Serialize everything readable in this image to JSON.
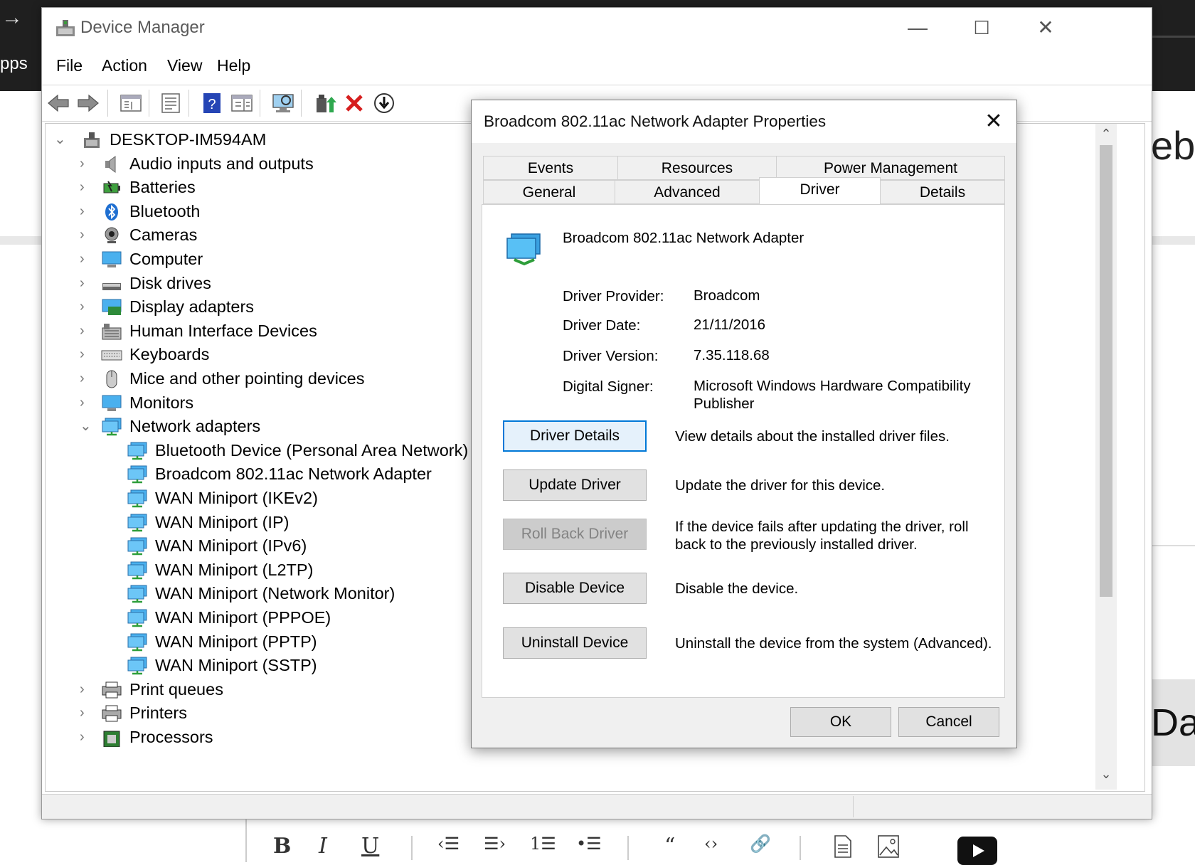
{
  "background": {
    "left_text": "pps",
    "right_text": "ebru",
    "right_text2": "Dat"
  },
  "window": {
    "title": "Device Manager",
    "controls": {
      "minimize": "—",
      "maximize": "☐",
      "close": "✕"
    }
  },
  "menu": [
    "File",
    "Action",
    "View",
    "Help"
  ],
  "tree": {
    "root": "DESKTOP-IM594AM",
    "categories": [
      {
        "label": "Audio inputs and outputs",
        "icon": "speaker-icon"
      },
      {
        "label": "Batteries",
        "icon": "battery-icon"
      },
      {
        "label": "Bluetooth",
        "icon": "bluetooth-icon"
      },
      {
        "label": "Cameras",
        "icon": "camera-icon"
      },
      {
        "label": "Computer",
        "icon": "computer-icon"
      },
      {
        "label": "Disk drives",
        "icon": "disk-icon"
      },
      {
        "label": "Display adapters",
        "icon": "display-adapter-icon"
      },
      {
        "label": "Human Interface Devices",
        "icon": "hid-icon"
      },
      {
        "label": "Keyboards",
        "icon": "keyboard-icon"
      },
      {
        "label": "Mice and other pointing devices",
        "icon": "mouse-icon"
      },
      {
        "label": "Monitors",
        "icon": "monitor-icon"
      },
      {
        "label": "Network adapters",
        "icon": "network-icon",
        "expanded": true
      }
    ],
    "network_children": [
      "Bluetooth Device (Personal Area Network)",
      "Broadcom 802.11ac Network Adapter",
      "WAN Miniport (IKEv2)",
      "WAN Miniport (IP)",
      "WAN Miniport (IPv6)",
      "WAN Miniport (L2TP)",
      "WAN Miniport (Network Monitor)",
      "WAN Miniport (PPPOE)",
      "WAN Miniport (PPTP)",
      "WAN Miniport (SSTP)"
    ],
    "after": [
      {
        "label": "Print queues",
        "icon": "printer-icon"
      },
      {
        "label": "Printers",
        "icon": "printer-icon"
      },
      {
        "label": "Processors",
        "icon": "processor-icon"
      }
    ]
  },
  "dialog": {
    "title": "Broadcom 802.11ac Network Adapter Properties",
    "tabs_row1": [
      "Events",
      "Resources",
      "Power Management"
    ],
    "tabs_row2": [
      "General",
      "Advanced",
      "Driver",
      "Details"
    ],
    "active_tab": "Driver",
    "device_name": "Broadcom 802.11ac Network Adapter",
    "info": [
      {
        "label": "Driver Provider:",
        "value": "Broadcom"
      },
      {
        "label": "Driver Date:",
        "value": "21/11/2016"
      },
      {
        "label": "Driver Version:",
        "value": "7.35.118.68"
      },
      {
        "label": "Digital Signer:",
        "value": "Microsoft Windows Hardware Compatibility Publisher"
      }
    ],
    "actions": [
      {
        "button": "Driver Details",
        "desc": "View details about the installed driver files."
      },
      {
        "button": "Update Driver",
        "desc": "Update the driver for this device."
      },
      {
        "button": "Roll Back Driver",
        "desc": "If the device fails after updating the driver, roll back to the previously installed driver.",
        "disabled": true
      },
      {
        "button": "Disable Device",
        "desc": "Disable the device."
      },
      {
        "button": "Uninstall Device",
        "desc": "Uninstall the device from the system (Advanced)."
      }
    ],
    "ok": "OK",
    "cancel": "Cancel"
  },
  "editor_toolbar": [
    "B",
    "I",
    "U",
    "‹☰",
    "☰›",
    "1☰",
    "•☰",
    "“",
    "‹›",
    "🔗"
  ]
}
